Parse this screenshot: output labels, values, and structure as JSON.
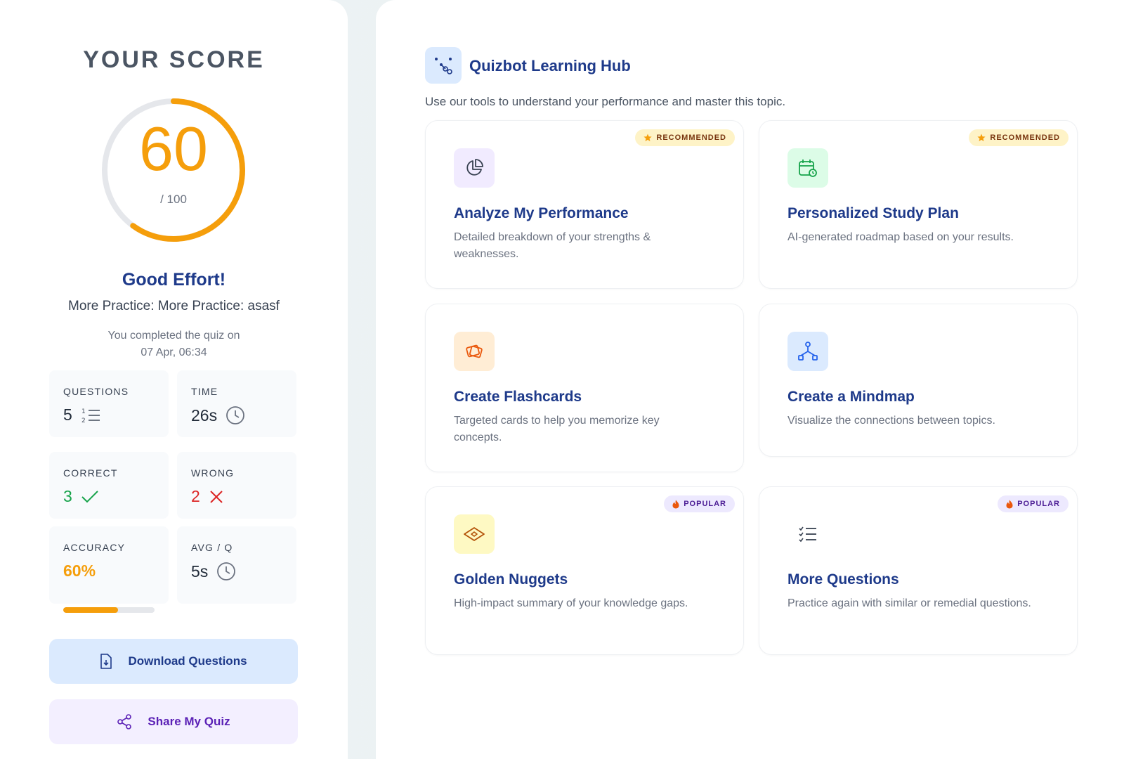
{
  "score": {
    "heading": "YOUR SCORE",
    "value": "60",
    "max_label": "/ 100",
    "fraction": 0.6,
    "effort": "Good Effort!",
    "quiz_name": "More Practice: More Practice: asasf",
    "completed_line1": "You completed the quiz on",
    "completed_line2": "07 Apr, 06:34"
  },
  "stats": {
    "questions": {
      "label": "QUESTIONS",
      "value": "5"
    },
    "time": {
      "label": "TIME",
      "value": "26s"
    },
    "correct": {
      "label": "CORRECT",
      "value": "3"
    },
    "wrong": {
      "label": "WRONG",
      "value": "2"
    },
    "accuracy": {
      "label": "ACCURACY",
      "value": "60%",
      "fraction": 0.6
    },
    "avg": {
      "label": "AVG / Q",
      "value": "5s"
    }
  },
  "actions": {
    "download_label": "Download Questions",
    "share_label": "Share My Quiz"
  },
  "hub": {
    "title": "Quizbot Learning Hub",
    "subtitle": "Use our tools to understand your performance and master this topic.",
    "cards": [
      {
        "title": "Analyze My Performance",
        "desc": "Detailed breakdown of your strengths & weaknesses.",
        "badge": "RECOMMENDED",
        "icon": "pie-chart-icon"
      },
      {
        "title": "Personalized Study Plan",
        "desc": "AI-generated roadmap based on your results.",
        "badge": "RECOMMENDED",
        "icon": "calendar-clock-icon"
      },
      {
        "title": "Create Flashcards",
        "desc": "Targeted cards to help you memorize key concepts.",
        "badge": "",
        "icon": "cards-icon"
      },
      {
        "title": "Create a Mindmap",
        "desc": "Visualize the connections between topics.",
        "badge": "",
        "icon": "network-icon"
      },
      {
        "title": "Golden Nuggets",
        "desc": "High-impact summary of your knowledge gaps.",
        "badge": "POPULAR",
        "icon": "gem-icon"
      },
      {
        "title": "More Questions",
        "desc": "Practice again with similar or remedial questions.",
        "badge": "POPULAR",
        "icon": "checklist-icon"
      }
    ]
  },
  "colors": {
    "accent_orange": "#f59e0b",
    "navy": "#1e3a8a",
    "correct_green": "#16a34a",
    "wrong_red": "#dc2626"
  }
}
